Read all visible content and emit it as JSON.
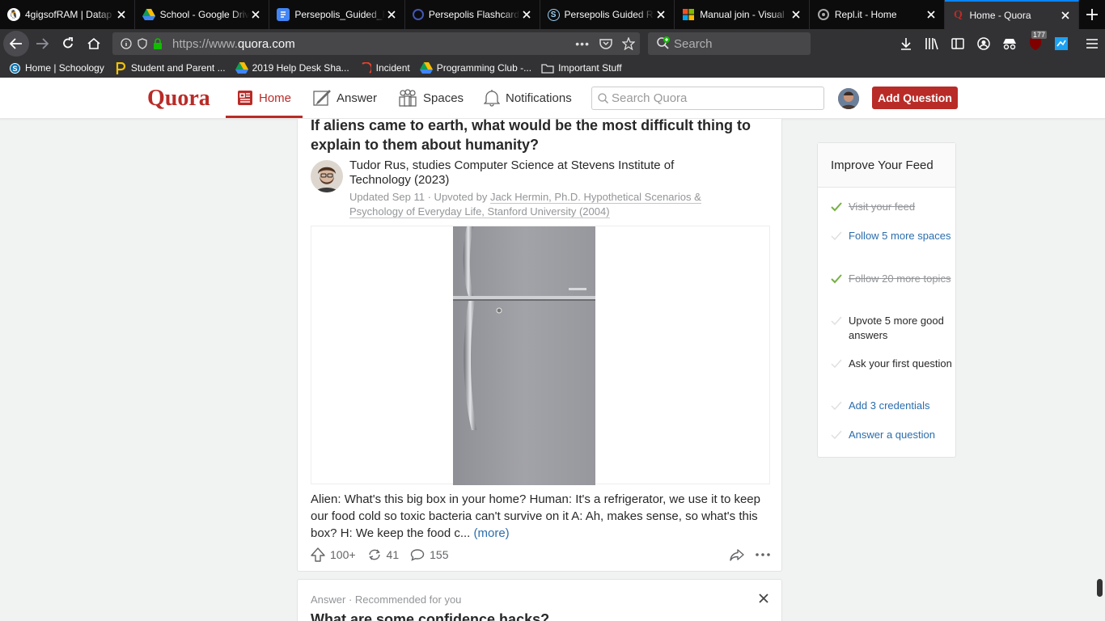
{
  "browser": {
    "tabs": [
      {
        "label": "4gigsofRAM | Datap",
        "icon": "penguin-icon",
        "color": "#e8e8e8"
      },
      {
        "label": "School - Google Driv",
        "icon": "google-drive-icon",
        "color": "#fbbc04"
      },
      {
        "label": "Persepolis_Guided_R",
        "icon": "google-docs-icon",
        "color": "#4285f4"
      },
      {
        "label": "Persepolis Flashcard",
        "icon": "quizlet-icon",
        "color": "#4257b2"
      },
      {
        "label": "Persepolis Guided R",
        "icon": "sparknotes-icon",
        "color": "#5aa1d8"
      },
      {
        "label": "Manual join - Visual",
        "icon": "microsoft-icon",
        "color": "#f25022"
      },
      {
        "label": "Repl.it - Home",
        "icon": "replit-icon",
        "color": "#aaaaaa"
      },
      {
        "label": "Home - Quora",
        "icon": "quora-icon",
        "color": "#b92b27"
      }
    ],
    "url_prefix": "https://www.",
    "url_domain": "quora.com",
    "search_placeholder": "Search",
    "badge_count": "177",
    "bookmarks": [
      {
        "label": "Home | Schoology",
        "icon": "schoology-icon"
      },
      {
        "label": "Student and Parent ...",
        "icon": "p-logo-icon"
      },
      {
        "label": "2019 Help Desk Sha...",
        "icon": "google-drive-icon"
      },
      {
        "label": "Incident",
        "icon": "incident-icon"
      },
      {
        "label": "Programming Club -...",
        "icon": "google-drive-icon"
      },
      {
        "label": "Important Stuff",
        "icon": "folder-icon"
      }
    ]
  },
  "quora": {
    "logo": "Quora",
    "nav": {
      "home": "Home",
      "answer": "Answer",
      "spaces": "Spaces",
      "notifications": "Notifications"
    },
    "search_placeholder": "Search Quora",
    "add_question": "Add Question",
    "brand_color": "#b92b27"
  },
  "post": {
    "question": "If aliens came to earth, what would be the most difficult thing to explain to them about humanity?",
    "author": "Tudor Rus, studies Computer Science at Stevens Institute of Technology (2023)",
    "meta_prefix": "Updated Sep 11 · Upvoted by ",
    "meta_upvoter": "Jack Hermin, Ph.D. Hypothetical Scenarios & Psychology of Everyday Life, Stanford University (2004)",
    "answer_text": "Alien: What's this big box in your home? Human: It's a refrigerator, we use it to keep our food cold so toxic bacteria can't survive on it A: Ah, makes sense, so what's this box? H: We keep the food c... ",
    "more_label": "(more)",
    "upvotes": "100+",
    "shares": "41",
    "comments": "155"
  },
  "next_post": {
    "label": "Answer · Recommended for you",
    "question": "What are some confidence hacks?"
  },
  "improve_feed": {
    "title": "Improve Your Feed",
    "items": [
      {
        "label": "Visit your feed",
        "state": "done"
      },
      {
        "label": "Follow 5 more spaces",
        "state": "link"
      },
      {
        "label": "Follow 20 more topics",
        "state": "done"
      },
      {
        "label": "Upvote 5 more good answers",
        "state": "plain"
      },
      {
        "label": "Ask your first question",
        "state": "plain"
      },
      {
        "label": "Add 3 credentials",
        "state": "link"
      },
      {
        "label": "Answer a question",
        "state": "link"
      }
    ]
  }
}
